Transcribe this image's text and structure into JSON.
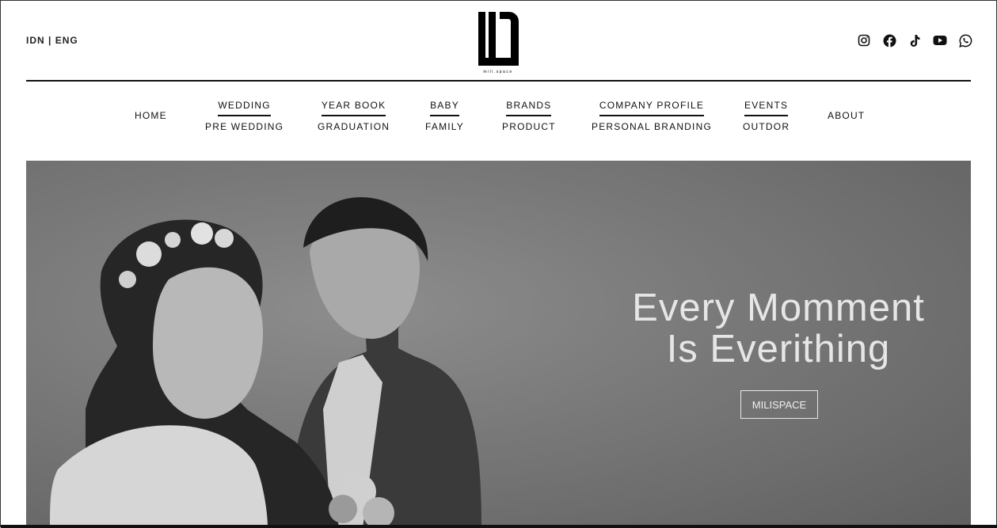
{
  "header": {
    "lang_idn": "IDN",
    "lang_sep": "|",
    "lang_eng": "ENG",
    "logo_text": "mili.space",
    "social_icons": [
      "instagram-icon",
      "facebook-icon",
      "tiktok-icon",
      "youtube-icon",
      "whatsapp-icon"
    ]
  },
  "nav": {
    "home": "HOME",
    "wedding": "WEDDING",
    "pre_wedding": "PRE WEDDING",
    "year_book": "YEAR BOOK",
    "graduation": "GRADUATION",
    "baby": "BABY",
    "family": "FAMILY",
    "brands": "BRANDS",
    "product": "PRODUCT",
    "company_profile": "COMPANY PROFILE",
    "personal_branding": "PERSONAL BRANDING",
    "events": "EVENTS",
    "outdor": "OUTDOR",
    "about": "ABOUT"
  },
  "hero": {
    "title_line1": "Every Momment",
    "title_line2": "Is Everithing",
    "button": "MILISPACE"
  }
}
